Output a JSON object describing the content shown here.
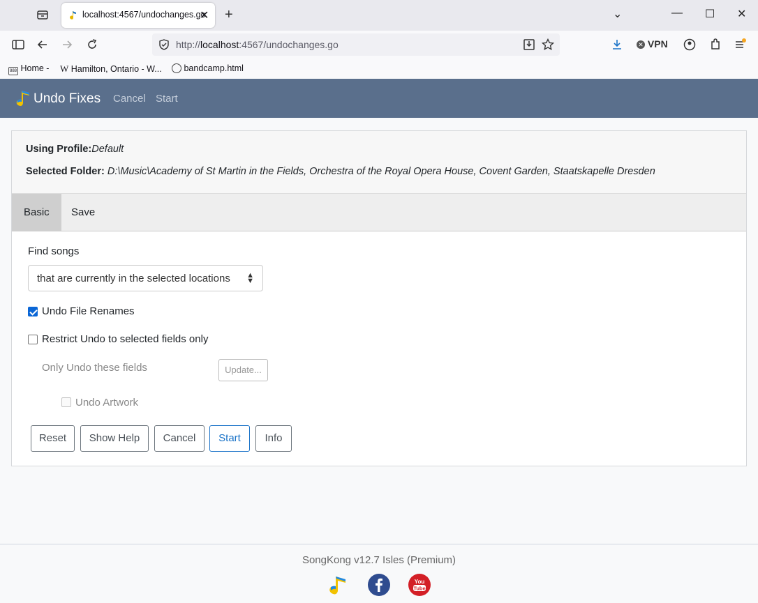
{
  "browser": {
    "tab_title": "localhost:4567/undochanges.go",
    "url_prefix": "http://",
    "url_host": "localhost",
    "url_rest": ":4567/undochanges.go",
    "vpn_label": "VPN",
    "bookmarks": [
      {
        "label": "Home -"
      },
      {
        "label": "Hamilton, Ontario - W..."
      },
      {
        "label": "bandcamp.html"
      }
    ]
  },
  "app": {
    "title": "Undo Fixes",
    "nav": [
      "Cancel",
      "Start"
    ],
    "header_color": "#5a6f8c"
  },
  "info": {
    "profile_label": "Using Profile:",
    "profile_value": "Default",
    "folder_label": "Selected Folder:",
    "folder_value": "D:\\Music\\Academy of St Martin in the Fields, Orchestra of the Royal Opera House, Covent Garden, Staatskapelle Dresden"
  },
  "tabs": [
    {
      "label": "Basic",
      "active": true
    },
    {
      "label": "Save",
      "active": false
    }
  ],
  "form": {
    "find_songs_label": "Find songs",
    "find_songs_value": "that are currently in the selected locations",
    "undo_renames_label": "Undo File Renames",
    "undo_renames_checked": true,
    "restrict_label": "Restrict Undo to selected fields only",
    "restrict_checked": false,
    "only_fields_label": "Only Undo these fields",
    "update_button": "Update...",
    "undo_artwork_label": "Undo Artwork",
    "undo_artwork_checked": false
  },
  "buttons": {
    "reset": "Reset",
    "show_help": "Show Help",
    "cancel": "Cancel",
    "start": "Start",
    "info": "Info"
  },
  "footer": {
    "version": "SongKong v12.7 Isles (Premium)",
    "icons": [
      "songkong-icon",
      "facebook-icon",
      "youtube-icon"
    ]
  }
}
